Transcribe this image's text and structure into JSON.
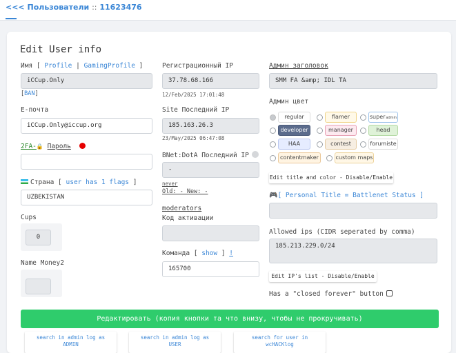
{
  "breadcrumb": {
    "back": "<<<",
    "section": "Пользователи",
    "sep": "::",
    "user_id": "11623476"
  },
  "title": "Edit User info",
  "name": {
    "label": "Имя",
    "link_profile": "Profile",
    "link_gaming": "GamingProfile",
    "value": "iCCup.Only",
    "ban": "BAN"
  },
  "email": {
    "label": "E-почта",
    "value": "iCCup.Only@iccup.org"
  },
  "password": {
    "label_2fa": "2FA-",
    "label": "Пароль",
    "value": ""
  },
  "country": {
    "label": "Страна",
    "flags_link": "user has 1 flags",
    "value": "UZBEKISTAN"
  },
  "cups": {
    "label": "Cups",
    "value": "0"
  },
  "money": {
    "label": "Name Money2"
  },
  "reg_ip": {
    "label": "Регистрационный IP",
    "value": "37.78.68.166",
    "date": "12/Feb/2025 17:01:48"
  },
  "site_ip": {
    "label": "Site Последний IP",
    "value": "185.163.26.3",
    "date": "23/May/2025 06:47:08"
  },
  "bnet_ip": {
    "label": "BNet:DotA Последний IP",
    "value": "-",
    "never": "never",
    "old_new": "Old: - New: -"
  },
  "moderators": {
    "label": "moderators"
  },
  "activation": {
    "label": "Код активации",
    "value": ""
  },
  "team": {
    "label": "Команда",
    "show": "show",
    "bang": "!",
    "value": "165700"
  },
  "admin_header": {
    "label": "Админ заголовок",
    "value": "SMM FA &amp; IDL TA"
  },
  "admin_color": {
    "label": "Админ цвет",
    "options": [
      {
        "label": "regular",
        "bg": "#ffffff",
        "border": "#dcdcdc",
        "color": "#444444"
      },
      {
        "label": "flamer",
        "bg": "#fff9e8",
        "border": "#f0d58a",
        "color": "#444444"
      },
      {
        "label": "super",
        "sub": "admin",
        "bg": "#ffffff",
        "border": "#9cc2ea",
        "color": "#444444"
      },
      {
        "label": "developer",
        "bg": "#5b6b8c",
        "border": "#4a5a7a",
        "color": "#ffffff"
      },
      {
        "label": "manager",
        "bg": "#fdeaf0",
        "border": "#e7a0b4",
        "color": "#444444"
      },
      {
        "label": "head",
        "bg": "#dff2d8",
        "border": "#b3d9a3",
        "color": "#444444"
      },
      {
        "label": "HAA",
        "bg": "#e6ecff",
        "border": "#b9c6ef",
        "color": "#444444"
      },
      {
        "label": "contest",
        "bg": "#f7eee2",
        "border": "#e5cba4",
        "color": "#444444"
      },
      {
        "label": "forumiste",
        "bg": "#ffffff",
        "border": "#dcdcdc",
        "color": "#444444"
      },
      {
        "label": "contentmaker",
        "bg": "#fff4e2",
        "border": "#eac89a",
        "color": "#444444"
      },
      {
        "label": "custom maps",
        "bg": "#fff7e6",
        "border": "#ecd29a",
        "color": "#444444"
      }
    ],
    "selected": "regular"
  },
  "toggle_title_color": "Edit title and color - Disable/Enable",
  "personal_title": {
    "label": "[ Personal Title = Battlenet Status ]",
    "value": ""
  },
  "allowed_ips": {
    "label": "Allowed ips (CIDR seperated by comma)",
    "value": "185.213.229.0/24"
  },
  "toggle_ips": "Edit IP's list - Disable/Enable",
  "closed_forever": {
    "label": "Has a \"closed forever\" button"
  },
  "submit": "Редактировать (копия кнопки та что внизу, чтобы не прокручивать)",
  "log_buttons": [
    {
      "line1": "search in admin log as",
      "line2": "ADMIN"
    },
    {
      "line1": "search in admin log as",
      "line2": "USER"
    },
    {
      "line1": "search for user in",
      "line2": "wcHACKlog"
    }
  ],
  "colors": {
    "accent": "#3a86d6",
    "submit_green": "#2fcc6c",
    "status_red": "#e60000"
  }
}
